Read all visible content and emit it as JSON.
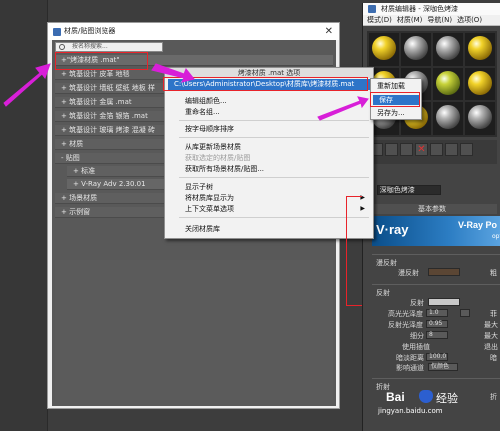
{
  "material_browser": {
    "title": "材质/贴图浏览器",
    "search_placeholder": "按名称搜索...",
    "rows": [
      "+\"烤漆材质 .mat\"",
      "+ 筑基设计    皮革     地毯",
      "+ 筑基设计    墙纸 壁纸  地板  样",
      "+ 筑基设计    金属 .mat",
      "+ 筑基设计    金箔  银箔 .mat",
      "+ 筑基设计    玻璃  烤漆  混凝  砖",
      "+ 材质",
      "- 贴图",
      "+ 标准",
      "+ V-Ray Adv 2.30.01",
      "+ 场景材质",
      "+ 示例窗"
    ]
  },
  "context_menu": {
    "header": "烤漆材质 .mat 选项",
    "path": "C:\\Users\\Administrator\\Desktop\\材质库\\烤漆材质.mat",
    "items": [
      {
        "label": "编辑组颜色...",
        "disabled": false,
        "submenu": false
      },
      {
        "label": "重命名组...",
        "disabled": false,
        "submenu": false
      },
      {
        "label": "按字母顺序排序",
        "disabled": false,
        "submenu": false
      },
      {
        "label": "从库更新场景材质",
        "disabled": false,
        "submenu": false
      },
      {
        "label": "获取选定的材质/贴图",
        "disabled": true,
        "submenu": false
      },
      {
        "label": "获取所有场景材质/贴图...",
        "disabled": false,
        "submenu": false
      },
      {
        "label": "显示子树",
        "disabled": false,
        "submenu": false
      },
      {
        "label": "将材质库显示为",
        "disabled": false,
        "submenu": true
      },
      {
        "label": "上下文菜单选项",
        "disabled": false,
        "submenu": true
      },
      {
        "label": "关闭材质库",
        "disabled": false,
        "submenu": false
      }
    ]
  },
  "submenu": {
    "items": [
      "重新加载",
      "保存",
      "另存为..."
    ],
    "highlighted": "保存"
  },
  "material_editor": {
    "title": "材质编辑器 - 深咖色烤漆",
    "menu": [
      "模式(D)",
      "材质(M)",
      "导航(N)",
      "选项(O)"
    ],
    "material_name": "深咖色烤漆",
    "section_basic": "基本参数",
    "vray_logo": "V·ray",
    "vray_product": "V-Ray Po",
    "vray_sub": "opti",
    "diffuse_section": "漫反射",
    "diffuse_label": "漫反射",
    "roughness_label": "粗",
    "reflect_section": "反射",
    "reflect_label": "反射",
    "hilight_gloss_label": "高光光泽度",
    "hilight_gloss_value": "1.0",
    "refl_gloss_label": "反射光泽度",
    "refl_gloss_value": "0.95",
    "subdivs_label": "细分",
    "subdivs_value": "8",
    "interp_label": "使用插值",
    "dim_dist_label": "暗淡距离",
    "dim_dist_value": "100.0",
    "affect_label": "影响通道",
    "affect_value": "仅颜色",
    "refract_label": "折射",
    "fresnel_label": "菲",
    "max_label": "最大",
    "max_label2": "最大",
    "exit_label": "退出",
    "dim_label": "暗",
    "refract_right": "折"
  },
  "watermark": {
    "logo": "Bai",
    "text": "经验",
    "url": "jingyan.baidu.com"
  }
}
